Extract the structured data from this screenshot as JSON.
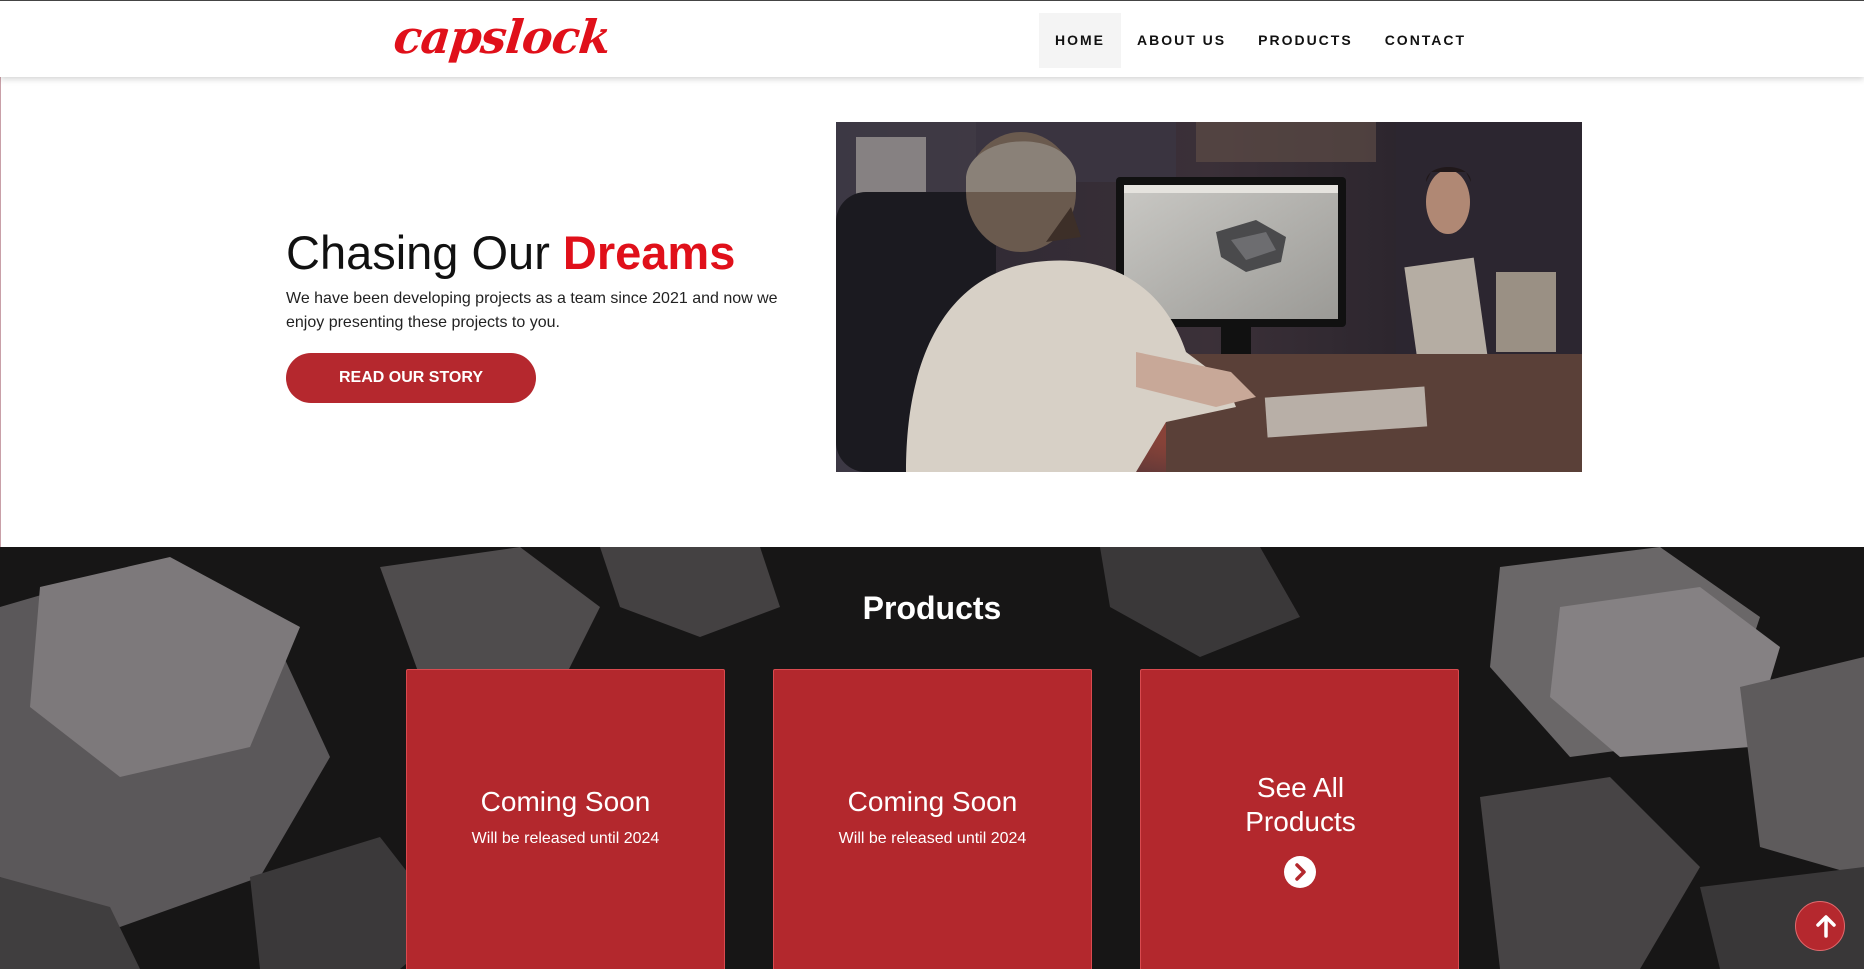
{
  "header": {
    "logo": "capslock",
    "nav": [
      {
        "label": "HOME",
        "active": true
      },
      {
        "label": "ABOUT US",
        "active": false
      },
      {
        "label": "PRODUCTS",
        "active": false
      },
      {
        "label": "CONTACT",
        "active": false
      }
    ]
  },
  "hero": {
    "title_plain": "Chasing Our ",
    "title_accent": "Dreams",
    "text": "We have been developing projects as a team since 2021 and now we enjoy presenting these projects to you.",
    "button_label": "READ OUR STORY"
  },
  "products": {
    "title": "Products",
    "cards": [
      {
        "title": "Coming Soon",
        "subtitle": "Will be released until 2024"
      },
      {
        "title": "Coming Soon",
        "subtitle": "Will be released until 2024"
      },
      {
        "title": "See All Products",
        "icon": "chevron-right-circle-icon"
      }
    ]
  },
  "scroll_top": {
    "icon": "arrow-up-icon"
  },
  "colors": {
    "brand_red": "#e0101a",
    "button_red": "#b5282e",
    "card_red": "#b3282d"
  }
}
